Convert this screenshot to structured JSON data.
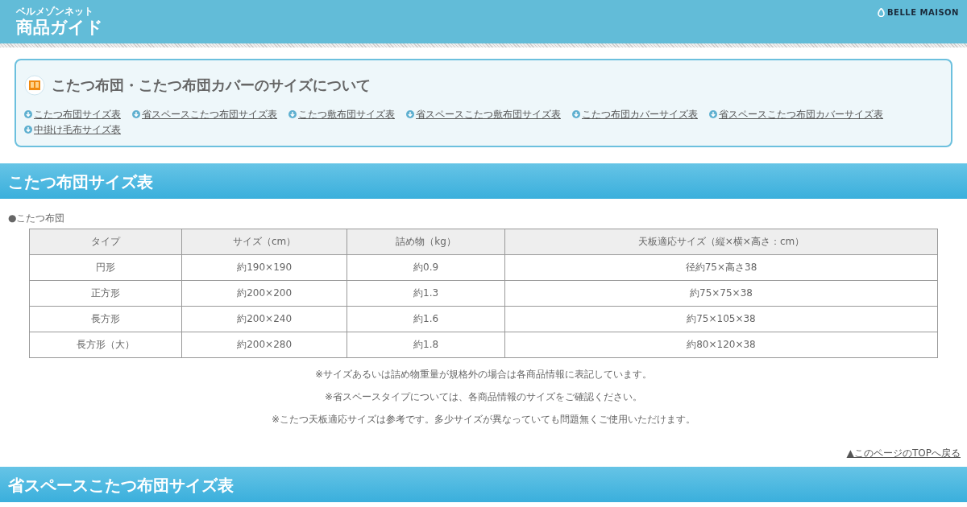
{
  "header": {
    "subtitle": "ベルメゾンネット",
    "title": "商品ガイド",
    "logo": "BELLE MAISON"
  },
  "intro": {
    "title": "こたつ布団・こたつ布団カバーのサイズについて",
    "links": [
      "こたつ布団サイズ表",
      "省スペースこたつ布団サイズ表",
      "こたつ敷布団サイズ表",
      "省スペースこたつ敷布団サイズ表",
      "こたつ布団カバーサイズ表",
      "省スペースこたつ布団カバーサイズ表",
      "中掛け毛布サイズ表"
    ]
  },
  "sections": [
    {
      "title": "こたつ布団サイズ表",
      "label": "●こたつ布団",
      "table": {
        "columns": [
          "タイプ",
          "サイズ（cm）",
          "詰め物（kg）",
          "天板適応サイズ（縦×横×高さ：cm）"
        ],
        "rows": [
          [
            "円形",
            "約190×190",
            "約0.9",
            "径約75×高さ38"
          ],
          [
            "正方形",
            "約200×200",
            "約1.3",
            "約75×75×38"
          ],
          [
            "長方形",
            "約200×240",
            "約1.6",
            "約75×105×38"
          ],
          [
            "長方形（大）",
            "約200×280",
            "約1.8",
            "約80×120×38"
          ]
        ]
      },
      "notes": [
        "※サイズあるいは詰め物重量が規格外の場合は各商品情報に表記しています。",
        "※省スペースタイプについては、各商品情報のサイズをご確認ください。",
        "※こたつ天板適応サイズは参考です。多少サイズが異なっていても問題無くご使用いただけます。"
      ],
      "top_link": "▲このページのTOPへ戻る"
    },
    {
      "title": "省スペースこたつ布団サイズ表"
    }
  ]
}
